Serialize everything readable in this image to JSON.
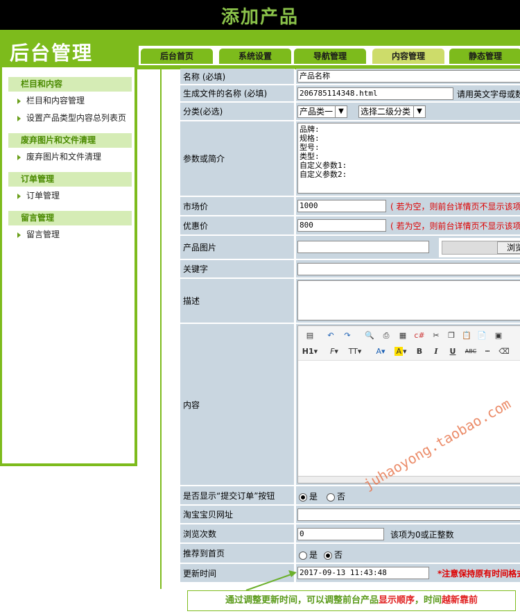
{
  "header": {
    "title": "添加产品",
    "logo": "后台管理"
  },
  "tabs": [
    {
      "label": "后台首页"
    },
    {
      "label": "系统设置"
    },
    {
      "label": "导航管理"
    },
    {
      "label": "内容管理"
    },
    {
      "label": "静态管理"
    }
  ],
  "sidebar": {
    "sections": [
      {
        "title": "栏目和内容",
        "items": [
          "栏目和内容管理",
          "设置产品类型内容总列表页"
        ]
      },
      {
        "title": "废弃图片和文件清理",
        "items": [
          "废弃图片和文件清理"
        ]
      },
      {
        "title": "订单管理",
        "items": [
          "订单管理"
        ]
      },
      {
        "title": "留言管理",
        "items": [
          "留言管理"
        ]
      }
    ]
  },
  "form": {
    "name_label": "名称 (必填)",
    "name_value": "产品名称",
    "filename_label": "生成文件的名称 (必填)",
    "filename_value": "206785114348.html",
    "filename_hint": "请用英文字母或数",
    "category_label": "分类(必选)",
    "category_value": "产品类一",
    "subcategory_value": "选择二级分类",
    "params_label": "参数或简介",
    "params_lines": [
      "品牌:",
      "规格:",
      "型号:",
      "类型:",
      "自定义参数1:",
      "自定义参数2:"
    ],
    "market_price_label": "市场价",
    "market_price_value": "1000",
    "market_price_hint": "( 若为空，则前台详情页不显示该项",
    "sale_price_label": "优惠价",
    "sale_price_value": "800",
    "sale_price_hint": "( 若为空，则前台详情页不显示该项",
    "image_label": "产品图片",
    "browse_label": "浏览",
    "keywords_label": "关键字",
    "desc_label": "描述",
    "content_label": "内容",
    "order_btn_label": "是否显示“提交订单”按钮",
    "yes": "是",
    "no": "否",
    "taobao_label": "淘宝宝贝网址",
    "views_label": "浏览次数",
    "views_value": "0",
    "views_hint": "该项为0或正整数",
    "recommend_label": "推荐到首页",
    "update_time_label": "更新时间",
    "update_time_value": "2017-09-13 11:43:48",
    "update_time_hint": "*注意保持原有时间格式"
  },
  "editor": {
    "heading_btn": "H1",
    "font_btn": "F",
    "size_btn": "TT",
    "color_btn": "A",
    "bg_btn": "A",
    "bold": "B",
    "italic": "I",
    "underline": "U",
    "strike": "ABC"
  },
  "annotation": {
    "part1": "通过调整更新时间，可以调整前台产品",
    "part2": "显示顺序",
    "part3": "，时间",
    "part4": "越新靠前"
  },
  "watermark": "juhaoyong.taobao.com",
  "colors": {
    "brand_green": "#7dbb1c",
    "label_bg": "#c9d6e0",
    "hint_red": "#dd0000"
  }
}
